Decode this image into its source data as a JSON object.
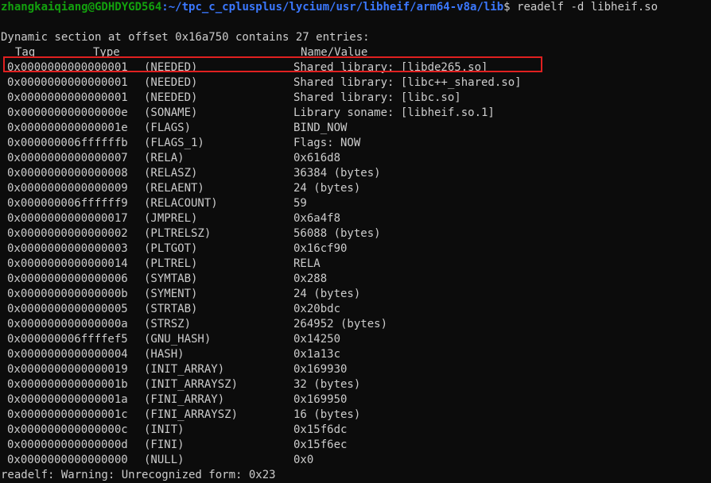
{
  "prompt": {
    "user_host": "zhangkaiqiang@GDHDYGD564",
    "path": ":~/tpc_c_cplusplus/lycium/usr/libheif/arm64-v8a/lib",
    "symbol": "$",
    "command": " readelf -d libheif.so"
  },
  "summary": "Dynamic section at offset 0x16a750 contains 27 entries:",
  "headers": {
    "tag": "Tag",
    "type": "Type",
    "value": "Name/Value"
  },
  "entries": [
    {
      "tag": "0x0000000000000001",
      "type": "(NEEDED)",
      "value": "Shared library: [libde265.so]"
    },
    {
      "tag": "0x0000000000000001",
      "type": "(NEEDED)",
      "value": "Shared library: [libc++_shared.so]"
    },
    {
      "tag": "0x0000000000000001",
      "type": "(NEEDED)",
      "value": "Shared library: [libc.so]"
    },
    {
      "tag": "0x000000000000000e",
      "type": "(SONAME)",
      "value": "Library soname: [libheif.so.1]"
    },
    {
      "tag": "0x000000000000001e",
      "type": "(FLAGS)",
      "value": "BIND_NOW"
    },
    {
      "tag": "0x000000006ffffffb",
      "type": "(FLAGS_1)",
      "value": "Flags: NOW"
    },
    {
      "tag": "0x0000000000000007",
      "type": "(RELA)",
      "value": "0x616d8"
    },
    {
      "tag": "0x0000000000000008",
      "type": "(RELASZ)",
      "value": "36384 (bytes)"
    },
    {
      "tag": "0x0000000000000009",
      "type": "(RELAENT)",
      "value": "24 (bytes)"
    },
    {
      "tag": "0x000000006ffffff9",
      "type": "(RELACOUNT)",
      "value": "59"
    },
    {
      "tag": "0x0000000000000017",
      "type": "(JMPREL)",
      "value": "0x6a4f8"
    },
    {
      "tag": "0x0000000000000002",
      "type": "(PLTRELSZ)",
      "value": "56088 (bytes)"
    },
    {
      "tag": "0x0000000000000003",
      "type": "(PLTGOT)",
      "value": "0x16cf90"
    },
    {
      "tag": "0x0000000000000014",
      "type": "(PLTREL)",
      "value": "RELA"
    },
    {
      "tag": "0x0000000000000006",
      "type": "(SYMTAB)",
      "value": "0x288"
    },
    {
      "tag": "0x000000000000000b",
      "type": "(SYMENT)",
      "value": "24 (bytes)"
    },
    {
      "tag": "0x0000000000000005",
      "type": "(STRTAB)",
      "value": "0x20bdc"
    },
    {
      "tag": "0x000000000000000a",
      "type": "(STRSZ)",
      "value": "264952 (bytes)"
    },
    {
      "tag": "0x000000006ffffef5",
      "type": "(GNU_HASH)",
      "value": "0x14250"
    },
    {
      "tag": "0x0000000000000004",
      "type": "(HASH)",
      "value": "0x1a13c"
    },
    {
      "tag": "0x0000000000000019",
      "type": "(INIT_ARRAY)",
      "value": "0x169930"
    },
    {
      "tag": "0x000000000000001b",
      "type": "(INIT_ARRAYSZ)",
      "value": "32 (bytes)"
    },
    {
      "tag": "0x000000000000001a",
      "type": "(FINI_ARRAY)",
      "value": "0x169950"
    },
    {
      "tag": "0x000000000000001c",
      "type": "(FINI_ARRAYSZ)",
      "value": "16 (bytes)"
    },
    {
      "tag": "0x000000000000000c",
      "type": "(INIT)",
      "value": "0x15f6dc"
    },
    {
      "tag": "0x000000000000000d",
      "type": "(FINI)",
      "value": "0x15f6ec"
    },
    {
      "tag": "0x0000000000000000",
      "type": "(NULL)",
      "value": "0x0"
    }
  ],
  "warning": "readelf: Warning: Unrecognized form: 0x23",
  "colors": {
    "background": "#0c0c0c",
    "text": "#cccccc",
    "prompt_user": "#13a10e",
    "prompt_path": "#3b78ff",
    "highlight_border": "#e02020"
  }
}
